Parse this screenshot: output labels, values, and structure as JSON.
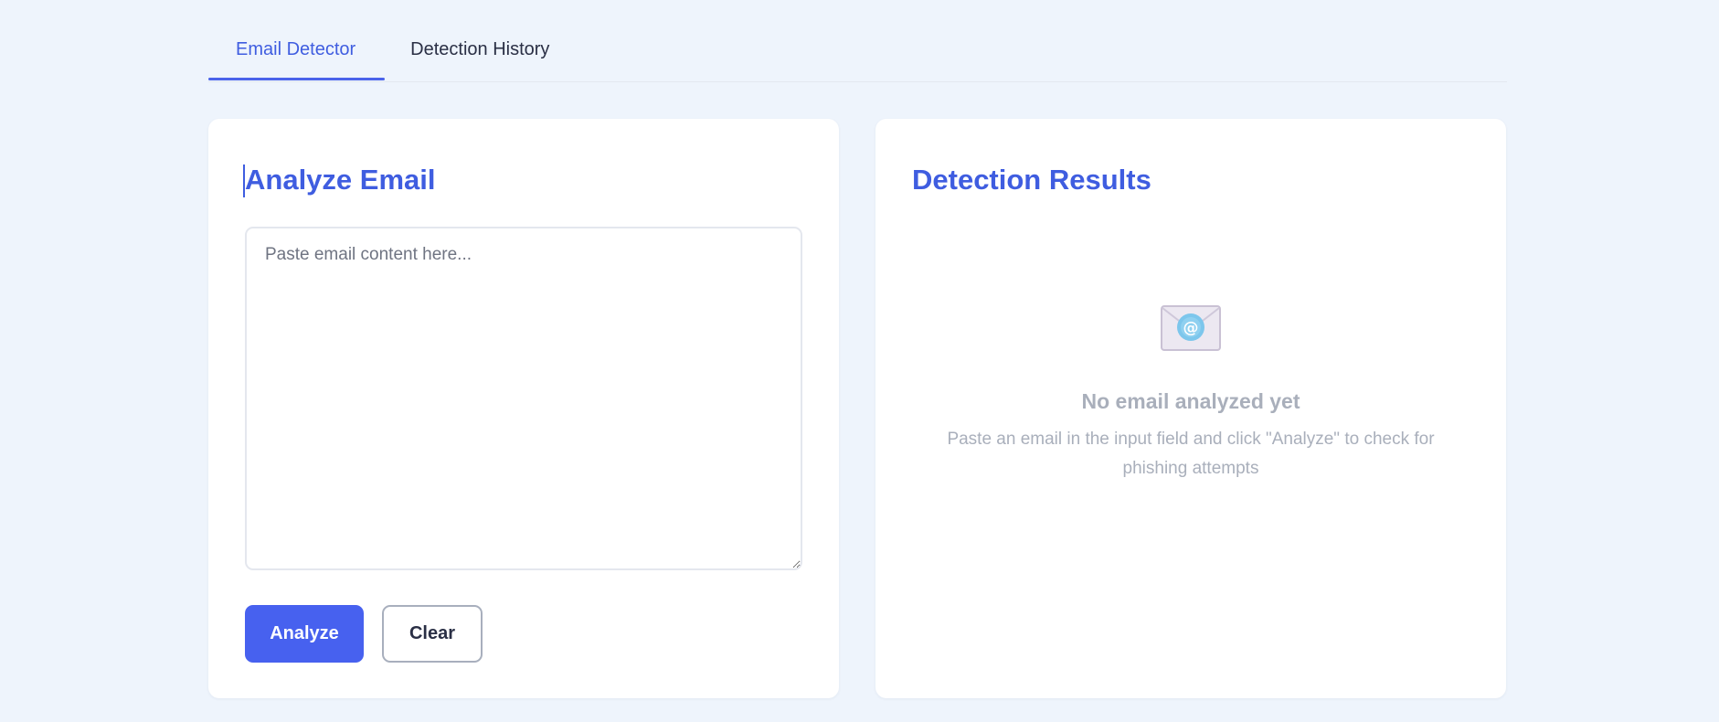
{
  "tabs": [
    {
      "label": "Email Detector",
      "active": true
    },
    {
      "label": "Detection History",
      "active": false
    }
  ],
  "analyze_panel": {
    "title": "Analyze Email",
    "textarea_placeholder": "Paste email content here...",
    "textarea_value": "",
    "analyze_label": "Analyze",
    "clear_label": "Clear"
  },
  "results_panel": {
    "title": "Detection Results",
    "icon": "envelope-at-icon",
    "empty_title": "No email analyzed yet",
    "empty_description": "Paste an email in the input field and click \"Analyze\" to check for phishing attempts"
  },
  "colors": {
    "background": "#eef4fc",
    "accent": "#3f5de0",
    "primary_button": "#4761ef",
    "muted_text": "#a9afbb"
  }
}
